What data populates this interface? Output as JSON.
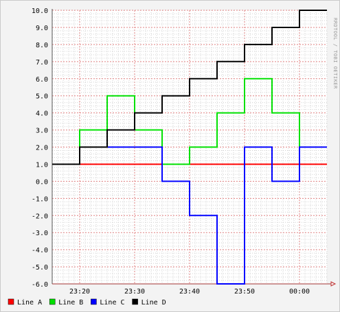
{
  "chart_data": {
    "type": "line",
    "title": "",
    "xlabel": "",
    "ylabel": "",
    "watermark": "RRDTOOL / TOBI OETIKER",
    "x_ticks": [
      "23:20",
      "23:30",
      "23:40",
      "23:50",
      "00:00"
    ],
    "x_tick_minutes": [
      20,
      30,
      40,
      50,
      60
    ],
    "xlim_minutes": [
      15,
      65
    ],
    "y_ticks": [
      "10.0",
      "9.0",
      "8.0",
      "7.0",
      "6.0",
      "5.0",
      "4.0",
      "3.0",
      "2.0",
      "1.0",
      "0.0",
      "-1.0",
      "-2.0",
      "-3.0",
      "-4.0",
      "-5.0",
      "-6.0"
    ],
    "ylim": [
      -6,
      10
    ],
    "grid": true,
    "legend_placement": "bottom-left",
    "series": [
      {
        "name": "Line A",
        "color": "#ff0000",
        "points": [
          [
            20,
            1
          ],
          [
            65,
            1
          ]
        ]
      },
      {
        "name": "Line B",
        "color": "#00e000",
        "points": [
          [
            20,
            1
          ],
          [
            20,
            3
          ],
          [
            25,
            3
          ],
          [
            25,
            5
          ],
          [
            30,
            5
          ],
          [
            30,
            3
          ],
          [
            35,
            3
          ],
          [
            35,
            1
          ],
          [
            40,
            1
          ],
          [
            40,
            2
          ],
          [
            45,
            2
          ],
          [
            45,
            4
          ],
          [
            50,
            4
          ],
          [
            50,
            6
          ],
          [
            55,
            6
          ],
          [
            55,
            4
          ],
          [
            60,
            4
          ],
          [
            60,
            2
          ]
        ]
      },
      {
        "name": "Line C",
        "color": "#0000ff",
        "points": [
          [
            20,
            1
          ],
          [
            20,
            2
          ],
          [
            35,
            2
          ],
          [
            35,
            0
          ],
          [
            40,
            0
          ],
          [
            40,
            -2
          ],
          [
            45,
            -2
          ],
          [
            45,
            -6
          ],
          [
            50,
            -6
          ],
          [
            50,
            2
          ],
          [
            55,
            2
          ],
          [
            55,
            0
          ],
          [
            60,
            0
          ],
          [
            60,
            2
          ],
          [
            65,
            2
          ]
        ]
      },
      {
        "name": "Line D",
        "color": "#000000",
        "points": [
          [
            15,
            1
          ],
          [
            20,
            1
          ],
          [
            20,
            2
          ],
          [
            25,
            2
          ],
          [
            25,
            3
          ],
          [
            30,
            3
          ],
          [
            30,
            4
          ],
          [
            35,
            4
          ],
          [
            35,
            5
          ],
          [
            40,
            5
          ],
          [
            40,
            6
          ],
          [
            45,
            6
          ],
          [
            45,
            7
          ],
          [
            50,
            7
          ],
          [
            50,
            8
          ],
          [
            55,
            8
          ],
          [
            55,
            9
          ],
          [
            60,
            9
          ],
          [
            60,
            10
          ],
          [
            65,
            10
          ]
        ]
      }
    ]
  }
}
